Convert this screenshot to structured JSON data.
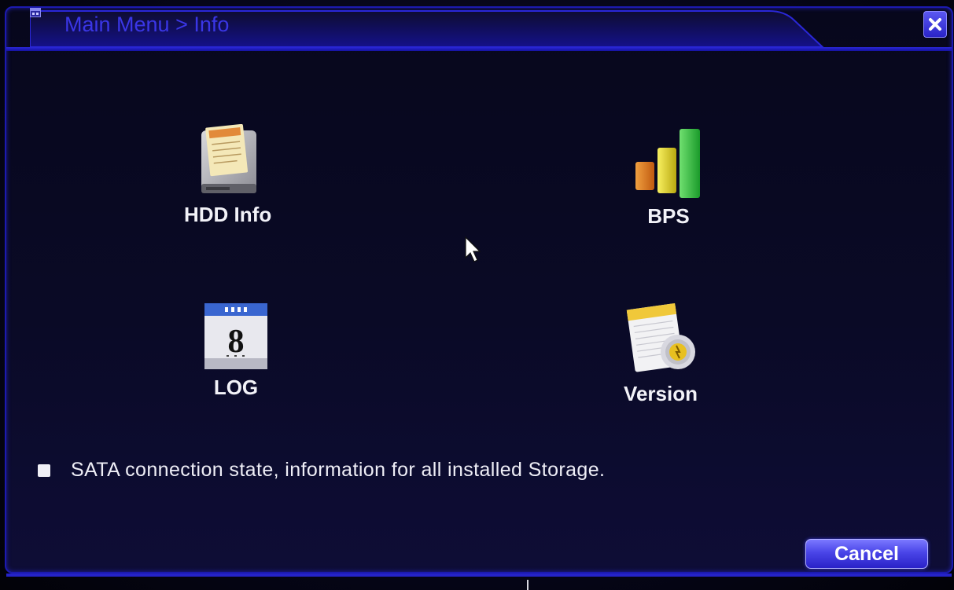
{
  "window": {
    "title": "Main Menu > Info",
    "close_icon": "close-icon"
  },
  "menu": {
    "items": [
      {
        "label": "HDD Info",
        "icon": "hdd-info-icon"
      },
      {
        "label": "BPS",
        "icon": "bar-chart-icon"
      },
      {
        "label": "LOG",
        "icon": "calendar-icon"
      },
      {
        "label": "Version",
        "icon": "version-document-icon"
      }
    ],
    "calendar_day": "8"
  },
  "description": "SATA connection state, information for all installed Storage.",
  "buttons": {
    "cancel": "Cancel"
  },
  "colors": {
    "accent": "#2a27d8",
    "title_text": "#3a36e6",
    "background": "#07071c"
  }
}
